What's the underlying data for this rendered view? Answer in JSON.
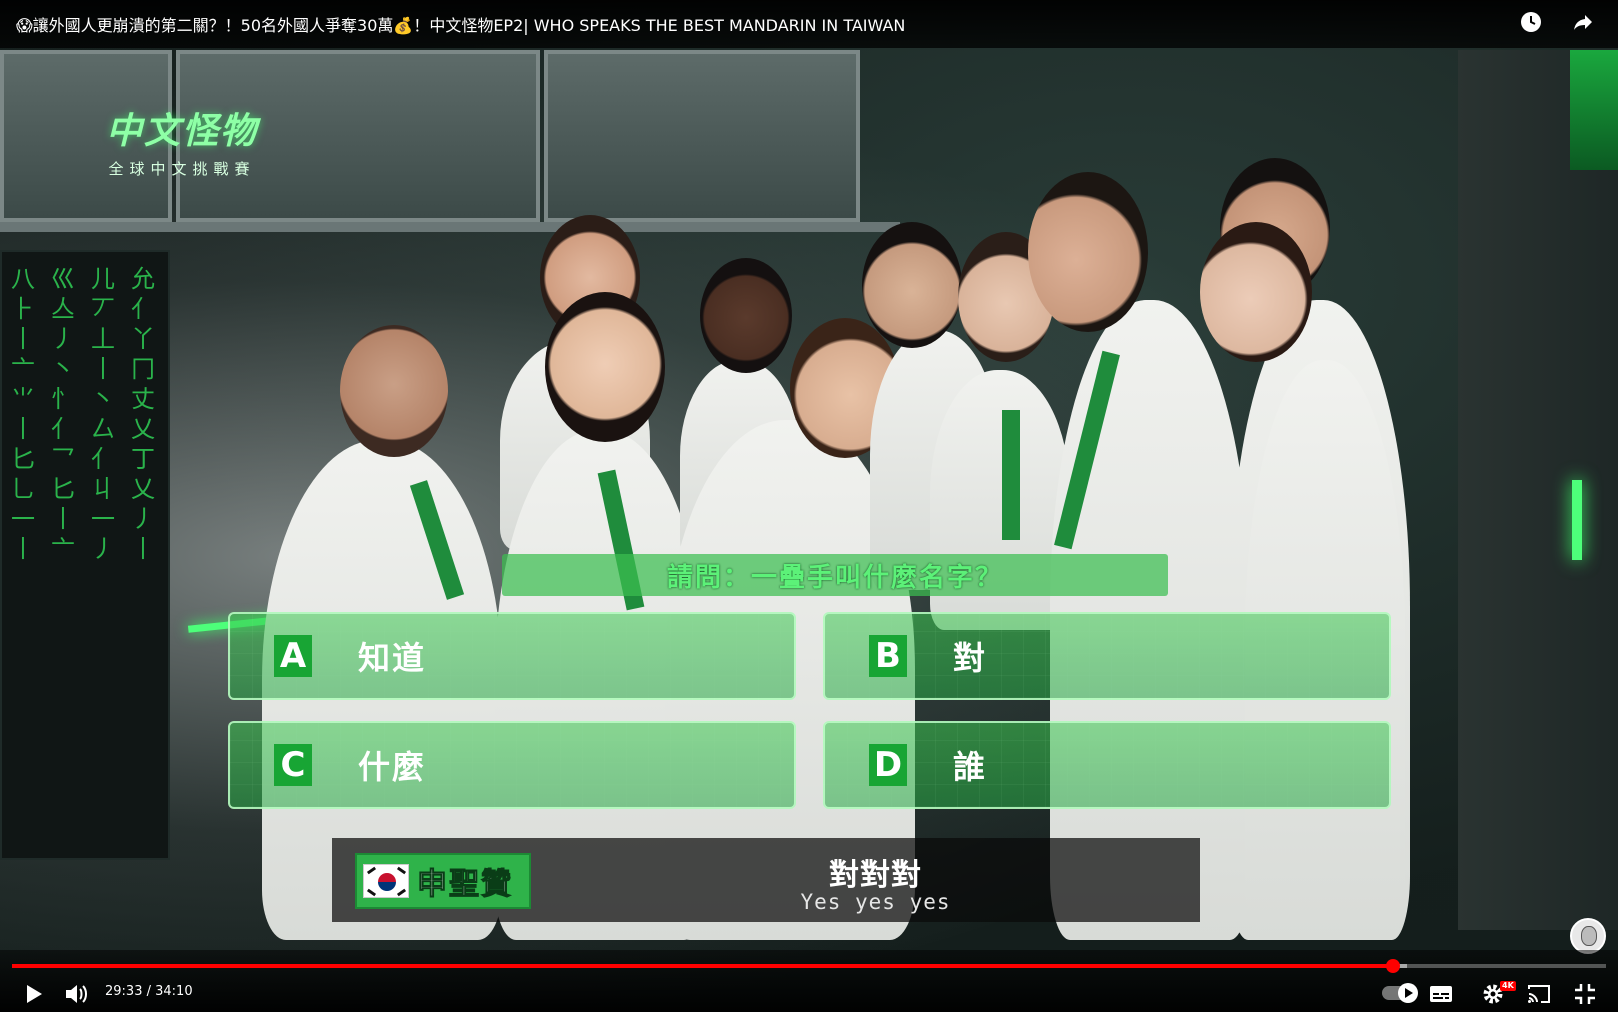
{
  "topbar": {
    "title": "😱讓外國人更崩潰的第二關？！50名外國人爭奪30萬💰！中文怪物EP2| WHO SPEAKS THE BEST MANDARIN IN TAIWAN",
    "watch_later_icon": "clock-icon",
    "share_icon": "share-icon"
  },
  "show_logo": {
    "line1": "中文怪物",
    "line2": "全球中文挑戰賽"
  },
  "matrix": [
    "八",
    "巛",
    "儿",
    "允"
  ],
  "quiz": {
    "question": "請問：一疊手叫什麼名字？",
    "options": [
      {
        "letter": "A",
        "text": "知道"
      },
      {
        "letter": "B",
        "text": "對"
      },
      {
        "letter": "C",
        "text": "什麼"
      },
      {
        "letter": "D",
        "text": "誰"
      }
    ]
  },
  "subtitle": {
    "speaker": "申聖贊",
    "zh": "對對對",
    "en": "Yes yes yes"
  },
  "progress": {
    "played_fraction": 0.8665,
    "buffered_fraction": 0.875
  },
  "controls": {
    "current_time": "29:33",
    "separator": " / ",
    "duration": "34:10",
    "hd_badge": "4K",
    "icons": [
      "play-icon",
      "volume-icon",
      "autoplay-icon",
      "subtitles-icon",
      "settings-icon",
      "cast-icon",
      "exit-fullscreen-icon"
    ]
  },
  "colors": {
    "accent_green": "#2fb34a",
    "progress_red": "#ff0000"
  }
}
